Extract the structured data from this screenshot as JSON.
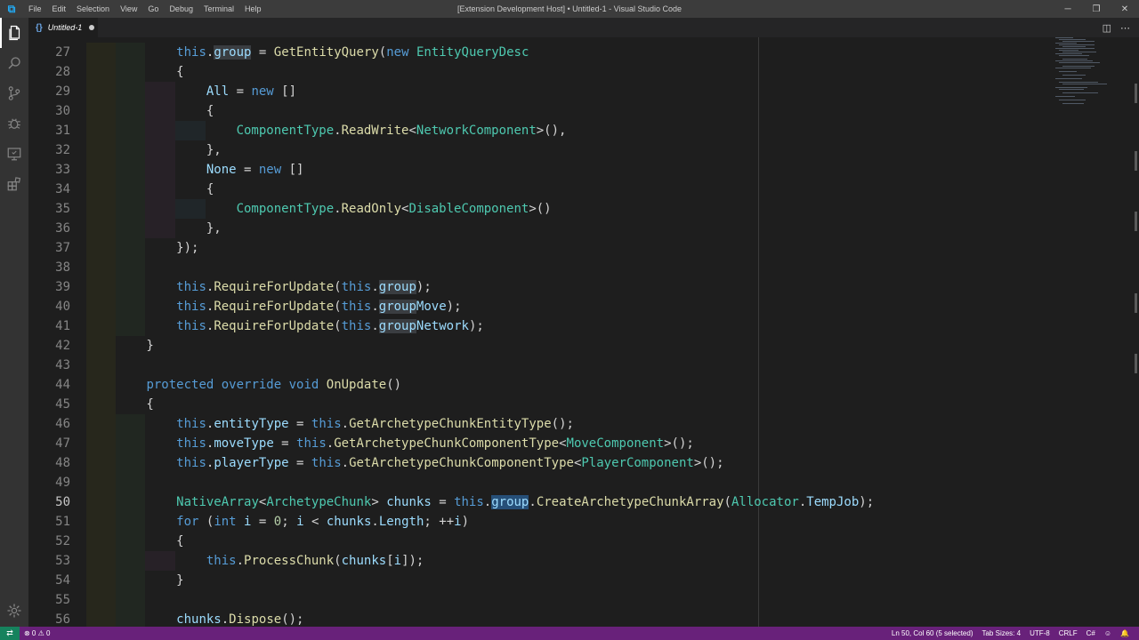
{
  "window": {
    "title": "[Extension Development Host] • Untitled-1 - Visual Studio Code",
    "controls": [
      "─",
      "❐",
      "✕"
    ]
  },
  "menu": [
    "File",
    "Edit",
    "Selection",
    "View",
    "Go",
    "Debug",
    "Terminal",
    "Help"
  ],
  "activity": [
    "files-icon",
    "search-icon",
    "source-control-icon",
    "debug-icon",
    "remote-explorer-icon",
    "extensions-icon"
  ],
  "tab": {
    "label": "Untitled-1",
    "dirty": true
  },
  "editor_actions": [
    "◫",
    "⋯"
  ],
  "editor": {
    "current_line": 50,
    "lines": [
      {
        "n": "27",
        "html": "    <span class='kw'>this</span>.<span class='pr hl2'>group</span> = <span class='fn'>GetEntityQuery</span>(<span class='kw'>new</span> <span class='ty'>EntityQueryDesc</span>"
      },
      {
        "n": "28",
        "html": "    {"
      },
      {
        "n": "29",
        "html": "        <span class='pr'>All</span> = <span class='kw'>new</span> []"
      },
      {
        "n": "30",
        "html": "        {"
      },
      {
        "n": "31",
        "html": "            <span class='ty'>ComponentType</span>.<span class='fn'>ReadWrite</span>&lt;<span class='ty'>NetworkComponent</span>&gt;(),"
      },
      {
        "n": "32",
        "html": "        },"
      },
      {
        "n": "33",
        "html": "        <span class='pr'>None</span> = <span class='kw'>new</span> []"
      },
      {
        "n": "34",
        "html": "        {"
      },
      {
        "n": "35",
        "html": "            <span class='ty'>ComponentType</span>.<span class='fn'>ReadOnly</span>&lt;<span class='ty'>DisableComponent</span>&gt;()"
      },
      {
        "n": "36",
        "html": "        },"
      },
      {
        "n": "37",
        "html": "    });"
      },
      {
        "n": "38",
        "html": ""
      },
      {
        "n": "39",
        "html": "    <span class='kw'>this</span>.<span class='fn'>RequireForUpdate</span>(<span class='kw'>this</span>.<span class='pr hl2'>group</span>);"
      },
      {
        "n": "40",
        "html": "    <span class='kw'>this</span>.<span class='fn'>RequireForUpdate</span>(<span class='kw'>this</span>.<span class='pr'><span class='hl2'>group</span>Move</span>);"
      },
      {
        "n": "41",
        "html": "    <span class='kw'>this</span>.<span class='fn'>RequireForUpdate</span>(<span class='kw'>this</span>.<span class='pr'><span class='hl2'>group</span>Network</span>);"
      },
      {
        "n": "42",
        "html": "}"
      },
      {
        "n": "43",
        "html": ""
      },
      {
        "n": "44",
        "html": "<span class='kw'>protected</span> <span class='kw'>override</span> <span class='kw'>void</span> <span class='fn'>OnUpdate</span>()"
      },
      {
        "n": "45",
        "html": "{"
      },
      {
        "n": "46",
        "html": "    <span class='kw'>this</span>.<span class='pr'>entityType</span> = <span class='kw'>this</span>.<span class='fn'>GetArchetypeChunkEntityType</span>();"
      },
      {
        "n": "47",
        "html": "    <span class='kw'>this</span>.<span class='pr'>moveType</span> = <span class='kw'>this</span>.<span class='fn'>GetArchetypeChunkComponentType</span>&lt;<span class='ty'>MoveComponent</span>&gt;();"
      },
      {
        "n": "48",
        "html": "    <span class='kw'>this</span>.<span class='pr'>playerType</span> = <span class='kw'>this</span>.<span class='fn'>GetArchetypeChunkComponentType</span>&lt;<span class='ty'>PlayerComponent</span>&gt;();"
      },
      {
        "n": "49",
        "html": ""
      },
      {
        "n": "50",
        "html": "    <span class='ty'>NativeArray</span>&lt;<span class='ty'>ArchetypeChunk</span>&gt; <span class='pr'>chunks</span> = <span class='kw'>this</span>.<span class='pr hl'>group</span>.<span class='fn'>CreateArchetypeChunkArray</span>(<span class='ty'>Allocator</span>.<span class='pr'>TempJob</span>);"
      },
      {
        "n": "51",
        "html": "    <span class='kw'>for</span> (<span class='kw'>int</span> <span class='pr'>i</span> = <span class='num'>0</span>; <span class='pr'>i</span> &lt; <span class='pr'>chunks</span>.<span class='pr'>Length</span>; ++<span class='pr'>i</span>)"
      },
      {
        "n": "52",
        "html": "    {"
      },
      {
        "n": "53",
        "html": "        <span class='kw'>this</span>.<span class='fn'>ProcessChunk</span>(<span class='pr'>chunks</span>[<span class='pr'>i</span>]);"
      },
      {
        "n": "54",
        "html": "    }"
      },
      {
        "n": "55",
        "html": ""
      },
      {
        "n": "56",
        "html": "    <span class='pr'>chunks</span>.<span class='fn'>Dispose</span>();"
      }
    ]
  },
  "status": {
    "remote": "⇄",
    "problems": "⊗ 0  ⚠ 0",
    "right": [
      "Ln 50, Col 60 (5 selected)",
      "Tab Sizes: 4",
      "UTF-8",
      "CRLF",
      "C#",
      "☺",
      "🔔"
    ]
  },
  "colors": {
    "titlebar": "#3c3c3c",
    "activitybar": "#333333",
    "editor": "#1e1e1e",
    "statusbar": "#68217a",
    "remote": "#16825d"
  }
}
